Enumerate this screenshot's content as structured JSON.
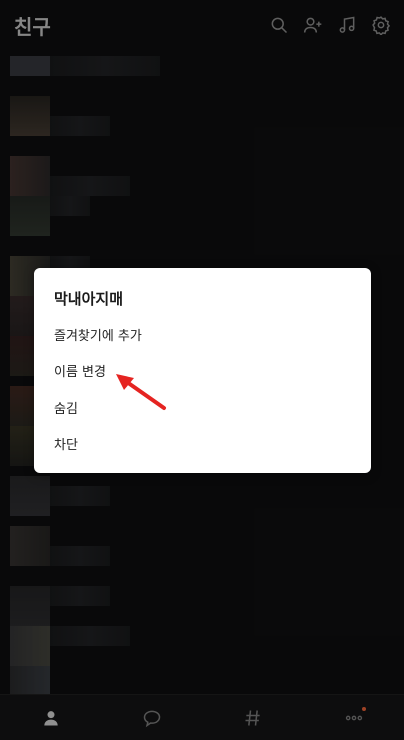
{
  "header": {
    "title": "친구",
    "icons": [
      "search-icon",
      "add-friend-icon",
      "music-icon",
      "settings-icon"
    ]
  },
  "context_menu": {
    "title": "막내아지매",
    "items": [
      "즐겨찾기에 추가",
      "이름 변경",
      "숨김",
      "차단"
    ]
  },
  "colors": {
    "background": "#101011",
    "accent_arrow": "#e52421",
    "badge": "#ff6b3d"
  },
  "tabbar": {
    "tabs": [
      "friends-tab-icon",
      "chat-tab-icon",
      "hashtag-tab-icon",
      "more-tab-icon"
    ]
  }
}
